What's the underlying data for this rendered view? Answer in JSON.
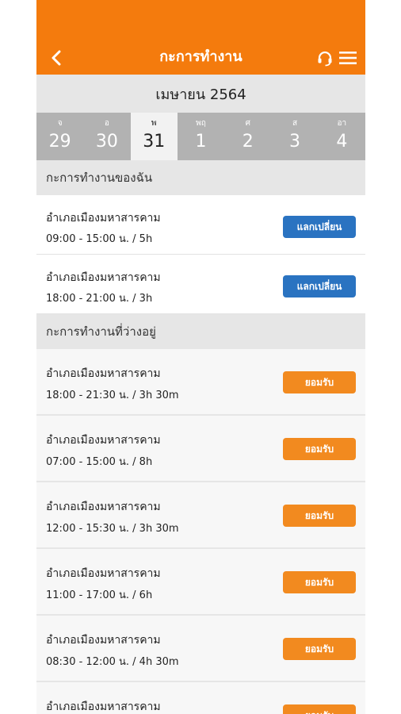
{
  "header": {
    "title": "กะการทำงาน"
  },
  "month": "เมษายน 2564",
  "week": [
    {
      "name": "จ",
      "num": "29"
    },
    {
      "name": "อ",
      "num": "30"
    },
    {
      "name": "พ",
      "num": "31"
    },
    {
      "name": "พฤ",
      "num": "1"
    },
    {
      "name": "ศ",
      "num": "2"
    },
    {
      "name": "ส",
      "num": "3"
    },
    {
      "name": "อา",
      "num": "4"
    }
  ],
  "my_shifts": {
    "heading": "กะการทำงานของฉัน",
    "button_label": "แลกเปลี่ยน",
    "items": [
      {
        "location": "อำเภอเมืองมหาสารคาม",
        "time": "09:00 - 15:00 น. / 5h"
      },
      {
        "location": "อำเภอเมืองมหาสารคาม",
        "time": "18:00 - 21:00 น. / 3h"
      }
    ]
  },
  "available_shifts": {
    "heading": "กะการทำงานที่ว่างอยู่",
    "button_label": "ยอมรับ",
    "items": [
      {
        "location": "อำเภอเมืองมหาสารคาม",
        "time": "18:00 - 21:30 น. / 3h 30m"
      },
      {
        "location": "อำเภอเมืองมหาสารคาม",
        "time": "07:00 - 15:00 น. / 8h"
      },
      {
        "location": "อำเภอเมืองมหาสารคาม",
        "time": "12:00 - 15:30 น. / 3h 30m"
      },
      {
        "location": "อำเภอเมืองมหาสารคาม",
        "time": "11:00 - 17:00 น. / 6h"
      },
      {
        "location": "อำเภอเมืองมหาสารคาม",
        "time": "08:30 - 12:00 น. / 4h 30m"
      },
      {
        "location": "อำเภอเมืองมหาสารคาม",
        "time": ""
      }
    ]
  },
  "colors": {
    "header": "#f47b0d",
    "swap_button": "#2a73c1",
    "accept_button": "#f28a1f",
    "week_bar": "#b2b2b2"
  },
  "icons": {
    "back": "chevron-left-icon",
    "support": "headset-icon",
    "menu": "hamburger-menu-icon"
  }
}
